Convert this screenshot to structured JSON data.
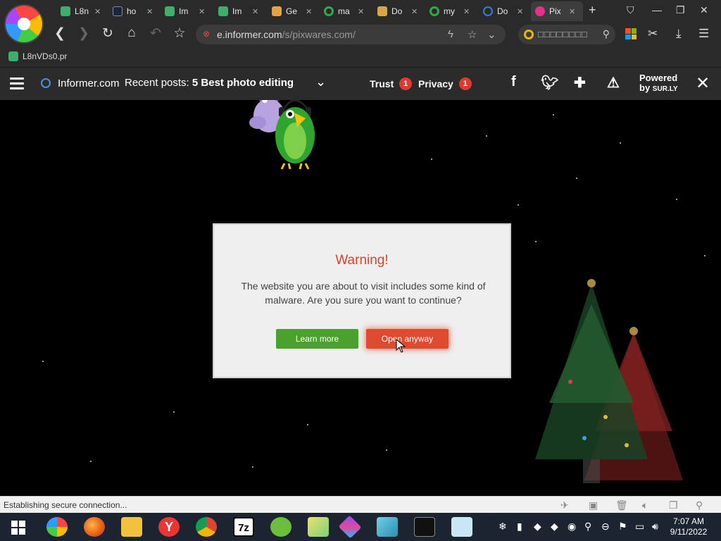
{
  "tabs": [
    {
      "label": "L8n",
      "favicon_color": "#3fae6a"
    },
    {
      "label": "ho",
      "favicon_color": "#1b2838"
    },
    {
      "label": "Im",
      "favicon_color": "#3fae6a"
    },
    {
      "label": "Im",
      "favicon_color": "#3fae6a"
    },
    {
      "label": "Ge",
      "favicon_color": "#e6a23c"
    },
    {
      "label": "ma",
      "favicon_color": "#2faa4a"
    },
    {
      "label": "Do",
      "favicon_color": "#d9a54b"
    },
    {
      "label": "my",
      "favicon_color": "#2faa4a"
    },
    {
      "label": "Do",
      "favicon_color": "#3a7bd5"
    },
    {
      "label": "Pix",
      "favicon_color": "#e6318c",
      "active": true
    }
  ],
  "address": {
    "host": "e.informer.com",
    "path": "/s/pixwares.com/",
    "search_placeholder": "□□□□□□□□"
  },
  "bookmark": {
    "label": "L8nVDs0.pr"
  },
  "infobar": {
    "site": "Informer.com",
    "recent_prefix": "Recent posts:",
    "recent_post": "5 Best photo editing",
    "trust_label": "Trust",
    "trust_count": "1",
    "privacy_label": "Privacy",
    "privacy_count": "1",
    "powered_line1": "Powered",
    "powered_by": "by",
    "powered_brand": "SUR.LY"
  },
  "dialog": {
    "title": "Warning!",
    "message": "The website you are about to visit includes some kind of malware. Are you sure you want to continue?",
    "learn_more": "Learn more",
    "open_anyway": "Open anyway"
  },
  "status": {
    "text": "Establishing secure connection..."
  },
  "clock": {
    "time": "7:07 AM",
    "date": "9/11/2022"
  },
  "colors": {
    "warning_title": "#d9442b",
    "learn_more_bg": "#4aa12e",
    "open_anyway_bg": "#e04a2f",
    "badge": "#e03a2e"
  }
}
